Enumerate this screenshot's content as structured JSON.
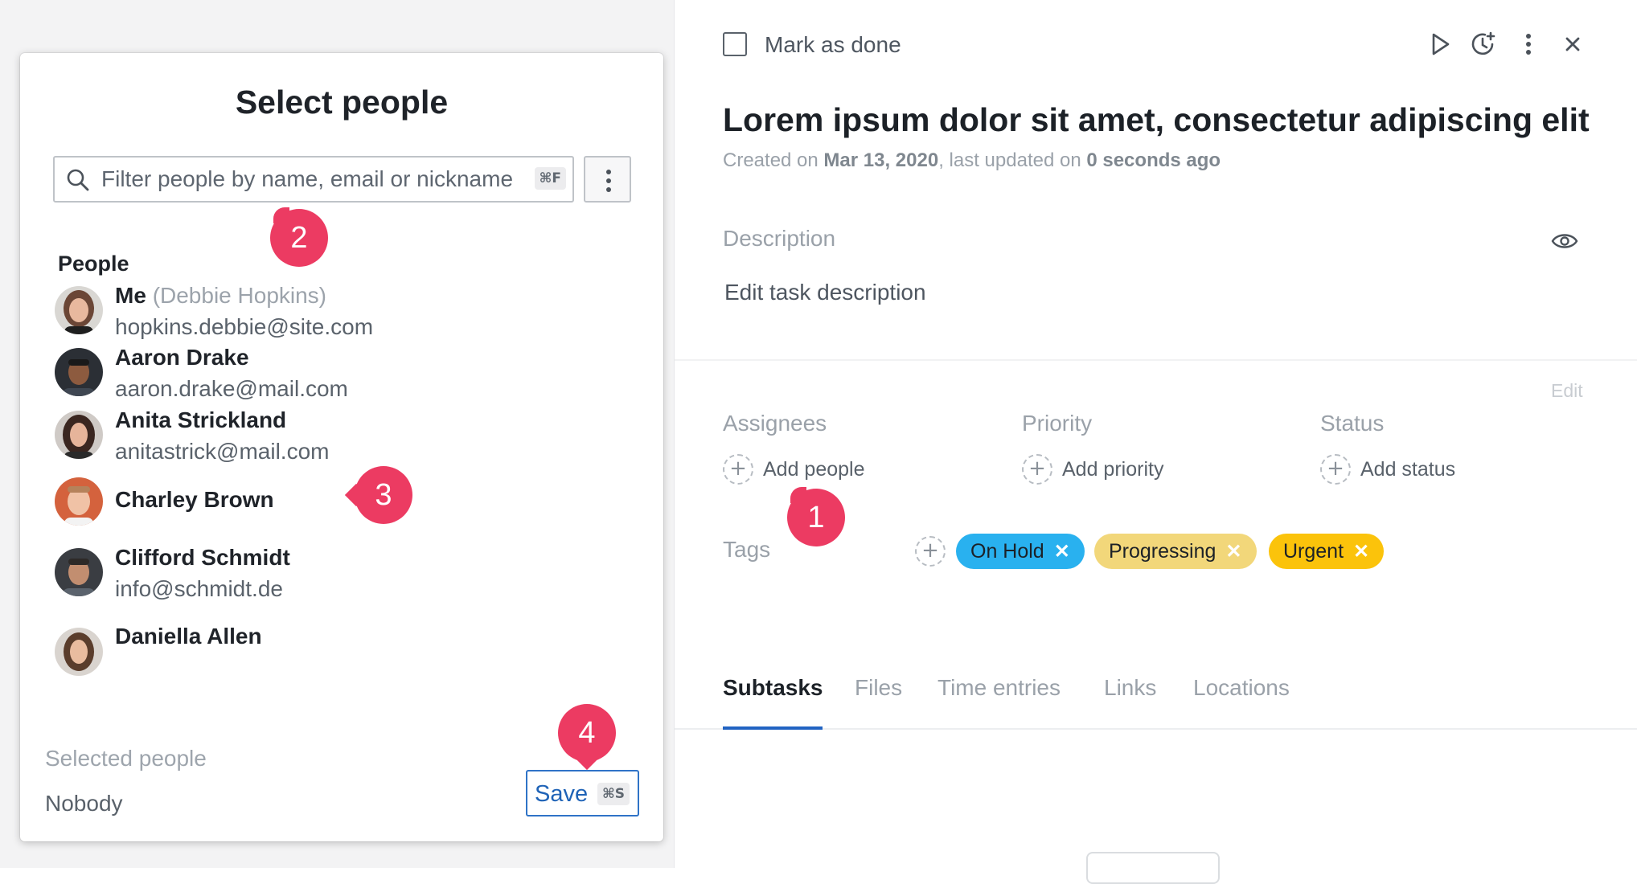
{
  "modal": {
    "title": "Select people",
    "search_placeholder": "Filter people by name, email or nickname",
    "search_shortcut": "⌘F",
    "section_label": "People",
    "people": [
      {
        "name": "Me",
        "alt": "(Debbie Hopkins)",
        "email": "hopkins.debbie@site.com"
      },
      {
        "name": "Aaron Drake",
        "alt": "",
        "email": "aaron.drake@mail.com"
      },
      {
        "name": "Anita Strickland",
        "alt": "",
        "email": "anitastrick@mail.com"
      },
      {
        "name": "Charley Brown",
        "alt": "",
        "email": ""
      },
      {
        "name": "Clifford Schmidt",
        "alt": "",
        "email": "info@schmidt.de"
      },
      {
        "name": "Daniella Allen",
        "alt": "",
        "email": ""
      }
    ],
    "selected_label": "Selected people",
    "selected_value": "Nobody",
    "save_label": "Save",
    "save_shortcut": "⌘S"
  },
  "task": {
    "mark_done_label": "Mark as done",
    "title": "Lorem ipsum dolor sit amet, consectetur adipiscing elit",
    "meta_created_prefix": "Created on ",
    "meta_created_date": "Mar 13, 2020",
    "meta_updated_prefix": ", last updated on ",
    "meta_updated_value": "0 seconds ago",
    "description_label": "Description",
    "description_placeholder": "Edit task description",
    "edit_label": "Edit",
    "fields": {
      "assignees": {
        "label": "Assignees",
        "action": "Add people"
      },
      "priority": {
        "label": "Priority",
        "action": "Add priority"
      },
      "status": {
        "label": "Status",
        "action": "Add status"
      }
    },
    "tags_label": "Tags",
    "tags": [
      {
        "label": "On Hold",
        "color": "#29b1ef",
        "x_color": "#ffffff"
      },
      {
        "label": "Progressing",
        "color": "#f2d77a",
        "x_color": "#ffffff"
      },
      {
        "label": "Urgent",
        "color": "#fbc30b",
        "x_color": "#ffffff"
      }
    ],
    "tabs": [
      "Subtasks",
      "Files",
      "Time entries",
      "Links",
      "Locations"
    ],
    "active_tab": "Subtasks"
  },
  "callouts": [
    "1",
    "2",
    "3",
    "4"
  ],
  "colors": {
    "accent": "#2163c2",
    "callout": "#ec3b62"
  }
}
